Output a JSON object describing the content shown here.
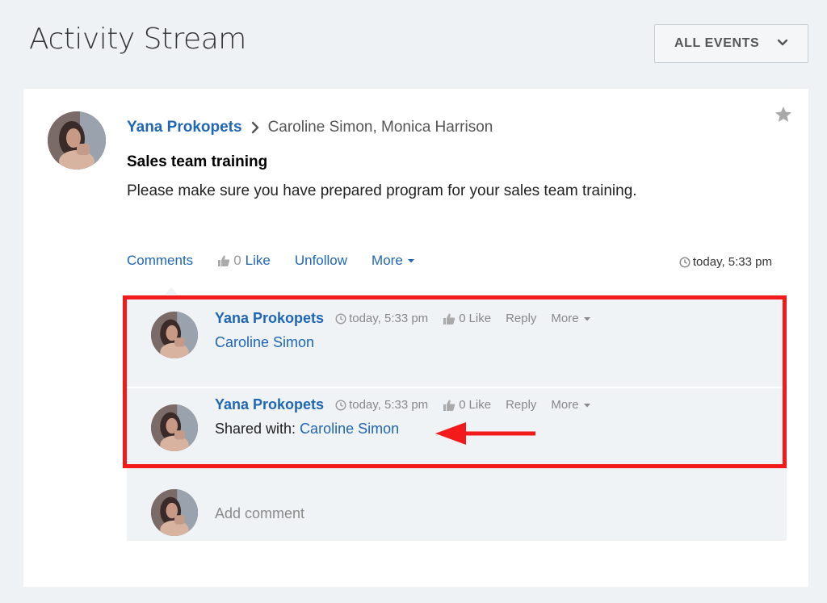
{
  "page": {
    "title": "Activity Stream"
  },
  "filter": {
    "label": "ALL EVENTS",
    "icon": "chevron-down-icon"
  },
  "post": {
    "author": "Yana Prokopets",
    "recipients": "Caroline Simon, Monica Harrison",
    "title": "Sales team training",
    "body": "Please make sure you have prepared program for your sales team training.",
    "actions": {
      "comments": "Comments",
      "like_count": "0",
      "like": "Like",
      "unfollow": "Unfollow",
      "more": "More"
    },
    "time": "today, 5:33 pm"
  },
  "comments": [
    {
      "author": "Yana Prokopets",
      "time": "today, 5:33 pm",
      "like_count": "0",
      "like": "Like",
      "reply": "Reply",
      "more": "More",
      "text_link": "Caroline Simon"
    },
    {
      "author": "Yana Prokopets",
      "time": "today, 5:33 pm",
      "like_count": "0",
      "like": "Like",
      "reply": "Reply",
      "more": "More",
      "text_prefix": "Shared with: ",
      "text_link": "Caroline Simon"
    }
  ],
  "add_comment": {
    "placeholder": "Add comment"
  },
  "colors": {
    "link": "#1f66b5",
    "highlight": "#f21a1a",
    "background": "#eef2f4"
  }
}
